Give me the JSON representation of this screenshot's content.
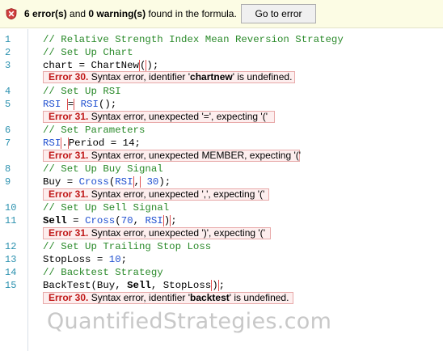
{
  "topbar": {
    "error_count": "6 error(s)",
    "and": " and ",
    "warning_count": "0 warning(s)",
    "found_text": " found in the formula.",
    "goto_label": "Go to error",
    "icon": "error-shield-icon",
    "icon_color": "#c83232"
  },
  "lines": [
    {
      "num": "1",
      "text": "// Relative Strength Index Mean Reversion Strategy"
    },
    {
      "num": "2",
      "text": "// Set Up Chart"
    },
    {
      "num": "3",
      "text": "chart = ChartNew();"
    },
    {
      "num": "4",
      "text": "// Set Up RSI"
    },
    {
      "num": "5",
      "text": "RSI = RSI();"
    },
    {
      "num": "6",
      "text": "// Set Parameters"
    },
    {
      "num": "7",
      "text": "RSI.Period = 14;"
    },
    {
      "num": "8",
      "text": "// Set Up Buy Signal"
    },
    {
      "num": "9",
      "text": "Buy = Cross(RSI, 30);"
    },
    {
      "num": "10",
      "text": "// Set Up Sell Signal"
    },
    {
      "num": "11",
      "text": "Sell = Cross(70, RSI);"
    },
    {
      "num": "12",
      "text": "// Set Up Trailing Stop Loss"
    },
    {
      "num": "13",
      "text": "StopLoss = 10;"
    },
    {
      "num": "14",
      "text": "// Backtest Strategy"
    },
    {
      "num": "15",
      "text": "BackTest(Buy, Sell, StopLoss);"
    }
  ],
  "errors": [
    {
      "code": "Error 30.",
      "pre": " Syntax error, identifier '",
      "ident": "chartnew",
      "post": "' is undefined."
    },
    {
      "code": "Error 31.",
      "pre": " Syntax error, unexpected '=', expecting '(",
      "ident": "",
      "post": "'"
    },
    {
      "code": "Error 31.",
      "pre": " Syntax error, unexpected MEMBER, expecting '(",
      "ident": "",
      "post": "'"
    },
    {
      "code": "Error 31.",
      "pre": " Syntax error, unexpected ',', expecting '(",
      "ident": "",
      "post": "'"
    },
    {
      "code": "Error 31.",
      "pre": " Syntax error, unexpected ')', expecting '(",
      "ident": "",
      "post": "'"
    },
    {
      "code": "Error 30.",
      "pre": " Syntax error, identifier '",
      "ident": "backtest",
      "post": "' is undefined."
    }
  ],
  "watermark": "QuantifiedStrategies.com",
  "colors": {
    "comment": "#2a8a2a",
    "builtin": "#2050d0",
    "line_number": "#2b91af",
    "error_code": "#c01818",
    "error_bg": "#fdeeee",
    "banner_bg": "#fcfce4"
  }
}
